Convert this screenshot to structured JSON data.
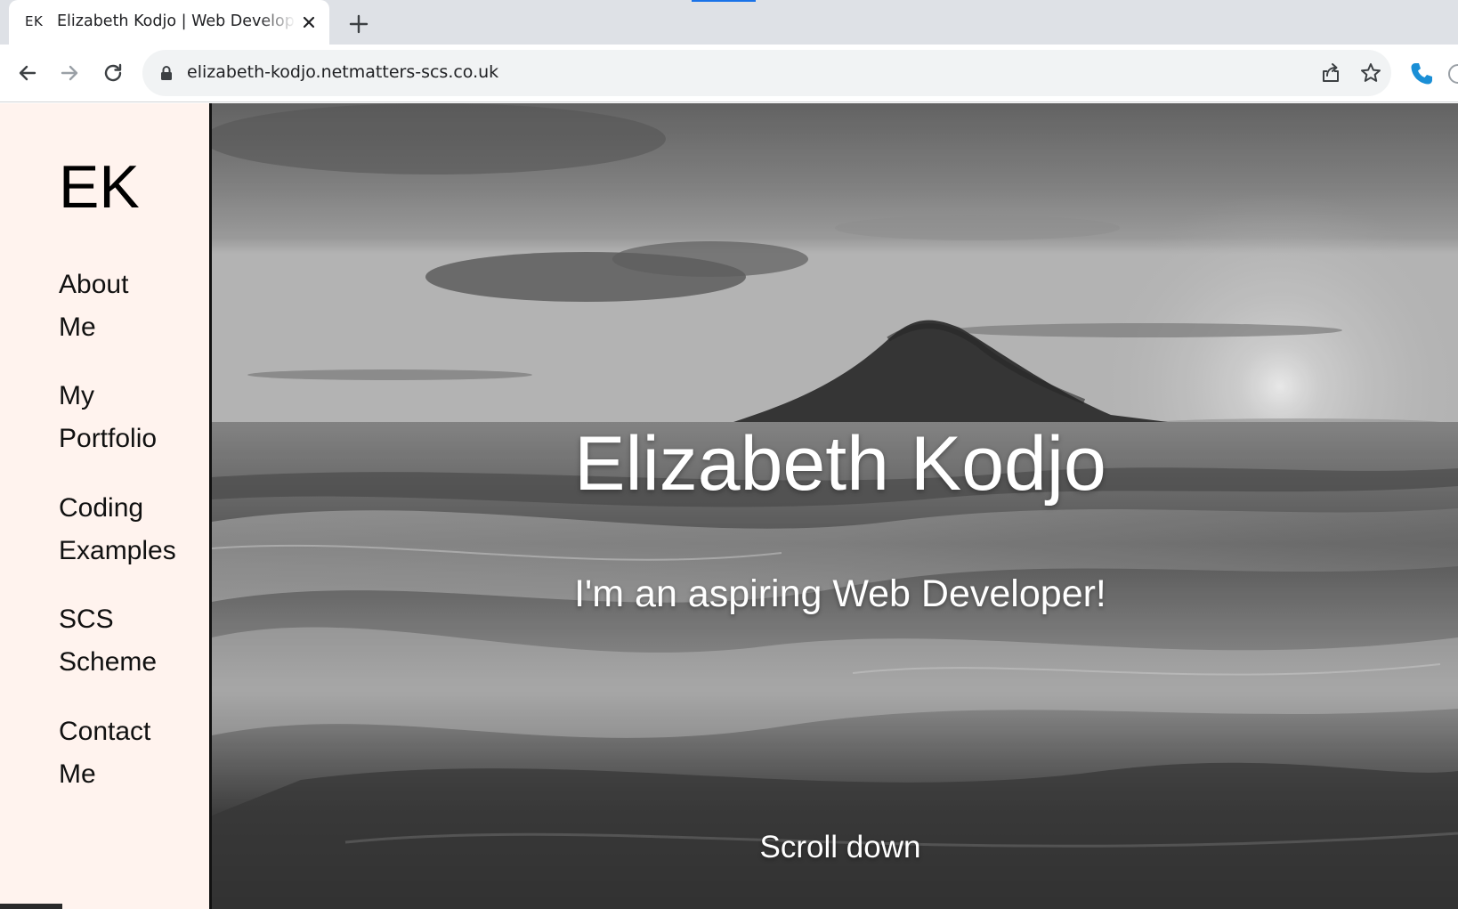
{
  "browser": {
    "tab": {
      "favicon_text": "EK",
      "title": "Elizabeth Kodjo | Web Developer",
      "close_icon": "close-icon"
    },
    "new_tab_icon": "plus-icon",
    "url": "elizabeth-kodjo.netmatters-scs.co.uk",
    "accent_color": "#1a73e8",
    "extension_color": "#1a8fd6"
  },
  "sidebar": {
    "logo": "EK",
    "background_color": "#fff3ee",
    "items": [
      {
        "word1": "About",
        "word2": "Me"
      },
      {
        "word1": "My",
        "word2": "Portfolio"
      },
      {
        "word1": "Coding",
        "word2": "Examples"
      },
      {
        "word1": "SCS",
        "word2": "Scheme"
      },
      {
        "word1": "Contact",
        "word2": "Me"
      }
    ]
  },
  "hero": {
    "title": "Elizabeth Kodjo",
    "subtitle": "I'm an aspiring Web Developer!",
    "scroll_label": "Scroll down"
  }
}
